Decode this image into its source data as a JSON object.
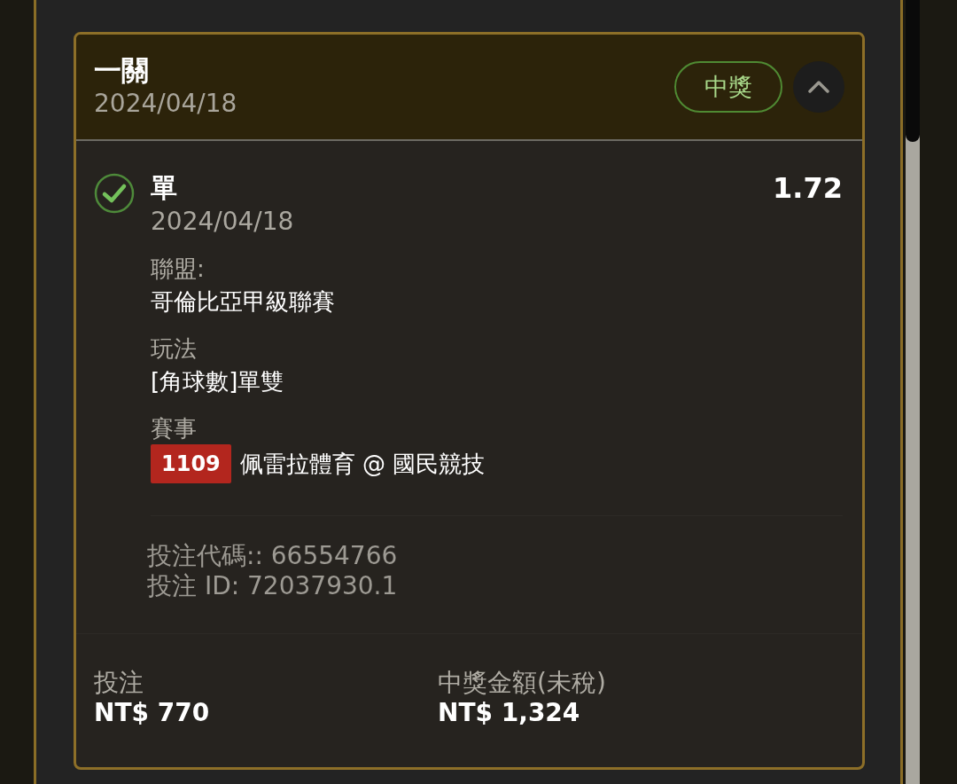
{
  "card": {
    "title": "一關",
    "date": "2024/04/18",
    "status": {
      "label": "中獎",
      "kind": "won"
    },
    "expanded": true,
    "selection": {
      "won": true,
      "pick": "單",
      "date": "2024/04/18",
      "odds": "1.72",
      "details": [
        {
          "label": "聯盟:",
          "value": "哥倫比亞甲級聯賽"
        },
        {
          "label": "玩法",
          "value": "[角球數]單雙"
        },
        {
          "label": "賽事",
          "value": "佩雷拉體育 @ 國民競技",
          "badge": "1109"
        }
      ],
      "codes": [
        "投注代碼:: 66554766",
        "投注 ID: 72037930.1"
      ]
    },
    "summary": [
      {
        "label": "投注",
        "value": "NT$ 770"
      },
      {
        "label": "中獎金額(未稅)",
        "value": "NT$ 1,324"
      }
    ]
  }
}
